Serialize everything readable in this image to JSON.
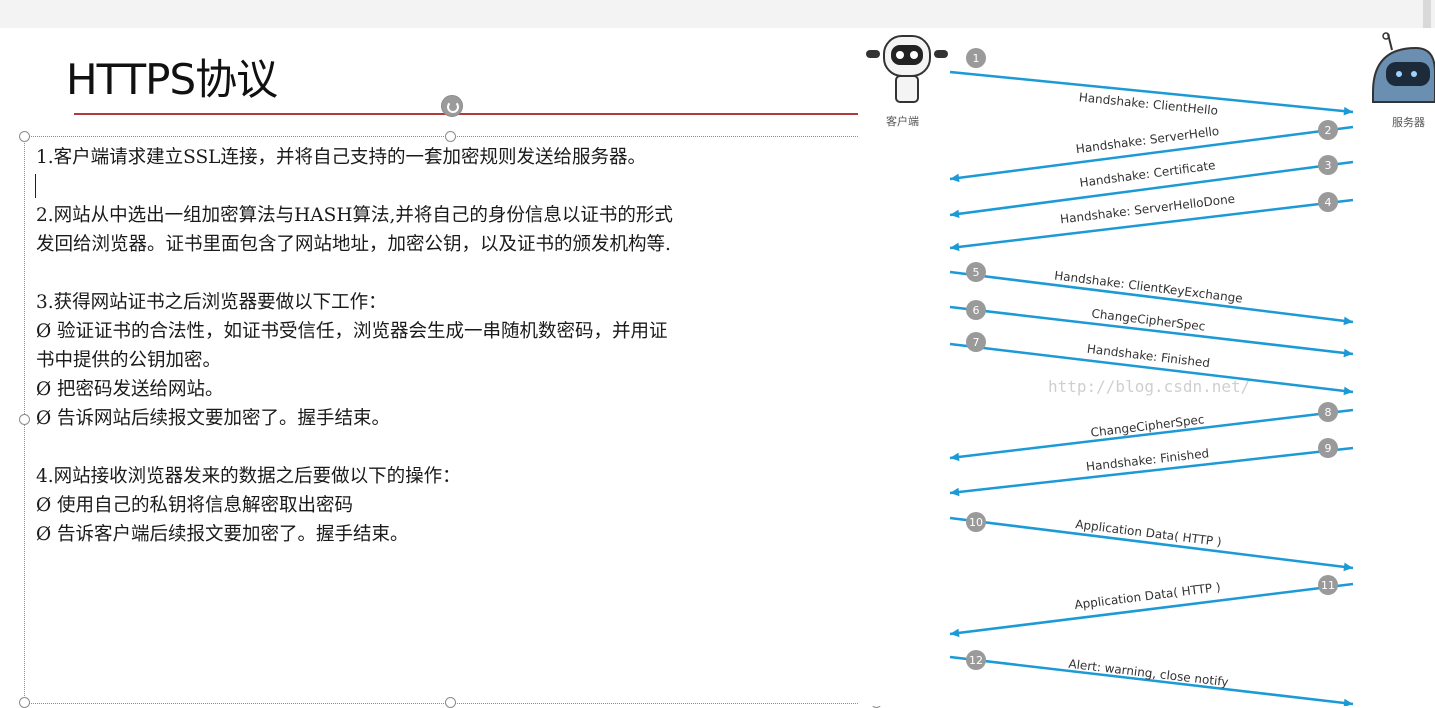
{
  "slide": {
    "title": "HTTPS协议",
    "lines": [
      "1.客户端请求建立SSL连接，并将自己支持的一套加密规则发送给服务器。",
      "",
      "2.网站从中选出一组加密算法与HASH算法,并将自己的身份信息以证书的形式",
      "发回给浏览器。证书里面包含了网站地址，加密公钥，以及证书的颁发机构等.",
      "",
      "3.获得网站证书之后浏览器要做以下工作：",
      "Ø  验证证书的合法性，如证书受信任，浏览器会生成一串随机数密码，并用证",
      "书中提供的公钥加密。",
      "Ø  把密码发送给网站。",
      "Ø  告诉网站后续报文要加密了。握手结束。",
      "",
      "4.网站接收浏览器发来的数据之后要做以下的操作：",
      "Ø  使用自己的私钥将信息解密取出密码",
      "Ø  告诉客户端后续报文要加密了。握手结束。"
    ]
  },
  "toolbar": {
    "buttons": [
      {
        "name": "collapse-button",
        "icon": "minus-circle-icon"
      },
      {
        "name": "text-style-button",
        "icon": "text-style-icon"
      },
      {
        "name": "layers-button",
        "icon": "layers-icon"
      },
      {
        "name": "pen-button",
        "icon": "pen-icon"
      },
      {
        "name": "fill-button",
        "icon": "paint-bucket-icon"
      },
      {
        "name": "frame-button",
        "icon": "frame-icon"
      },
      {
        "name": "font-button",
        "icon": "character-icon"
      },
      {
        "name": "text-box-button",
        "icon": "text-box-icon"
      },
      {
        "name": "arrange-button",
        "icon": "arrange-icon"
      }
    ],
    "active_button": "text-style-button"
  },
  "diagram": {
    "client_label": "客户端",
    "server_label": "服务器",
    "watermark": "http://blog.csdn.net/",
    "accent_color": "#1b9ad6",
    "messages": [
      {
        "n": "1",
        "label": "Handshake: ClientHello",
        "dir": "to-server"
      },
      {
        "n": "2",
        "label": "Handshake: ServerHello",
        "dir": "to-client"
      },
      {
        "n": "3",
        "label": "Handshake: Certificate",
        "dir": "to-client"
      },
      {
        "n": "4",
        "label": "Handshake: ServerHelloDone",
        "dir": "to-client"
      },
      {
        "n": "5",
        "label": "Handshake: ClientKeyExchange",
        "dir": "to-server"
      },
      {
        "n": "6",
        "label": "ChangeCipherSpec",
        "dir": "to-server"
      },
      {
        "n": "7",
        "label": "Handshake: Finished",
        "dir": "to-server"
      },
      {
        "n": "8",
        "label": "ChangeCipherSpec",
        "dir": "to-client"
      },
      {
        "n": "9",
        "label": "Handshake: Finished",
        "dir": "to-client"
      },
      {
        "n": "10",
        "label": "Application Data( HTTP )",
        "dir": "to-server"
      },
      {
        "n": "11",
        "label": "Application Data( HTTP )",
        "dir": "to-client"
      },
      {
        "n": "12",
        "label": "Alert: warning, close notify",
        "dir": "to-server"
      }
    ]
  }
}
